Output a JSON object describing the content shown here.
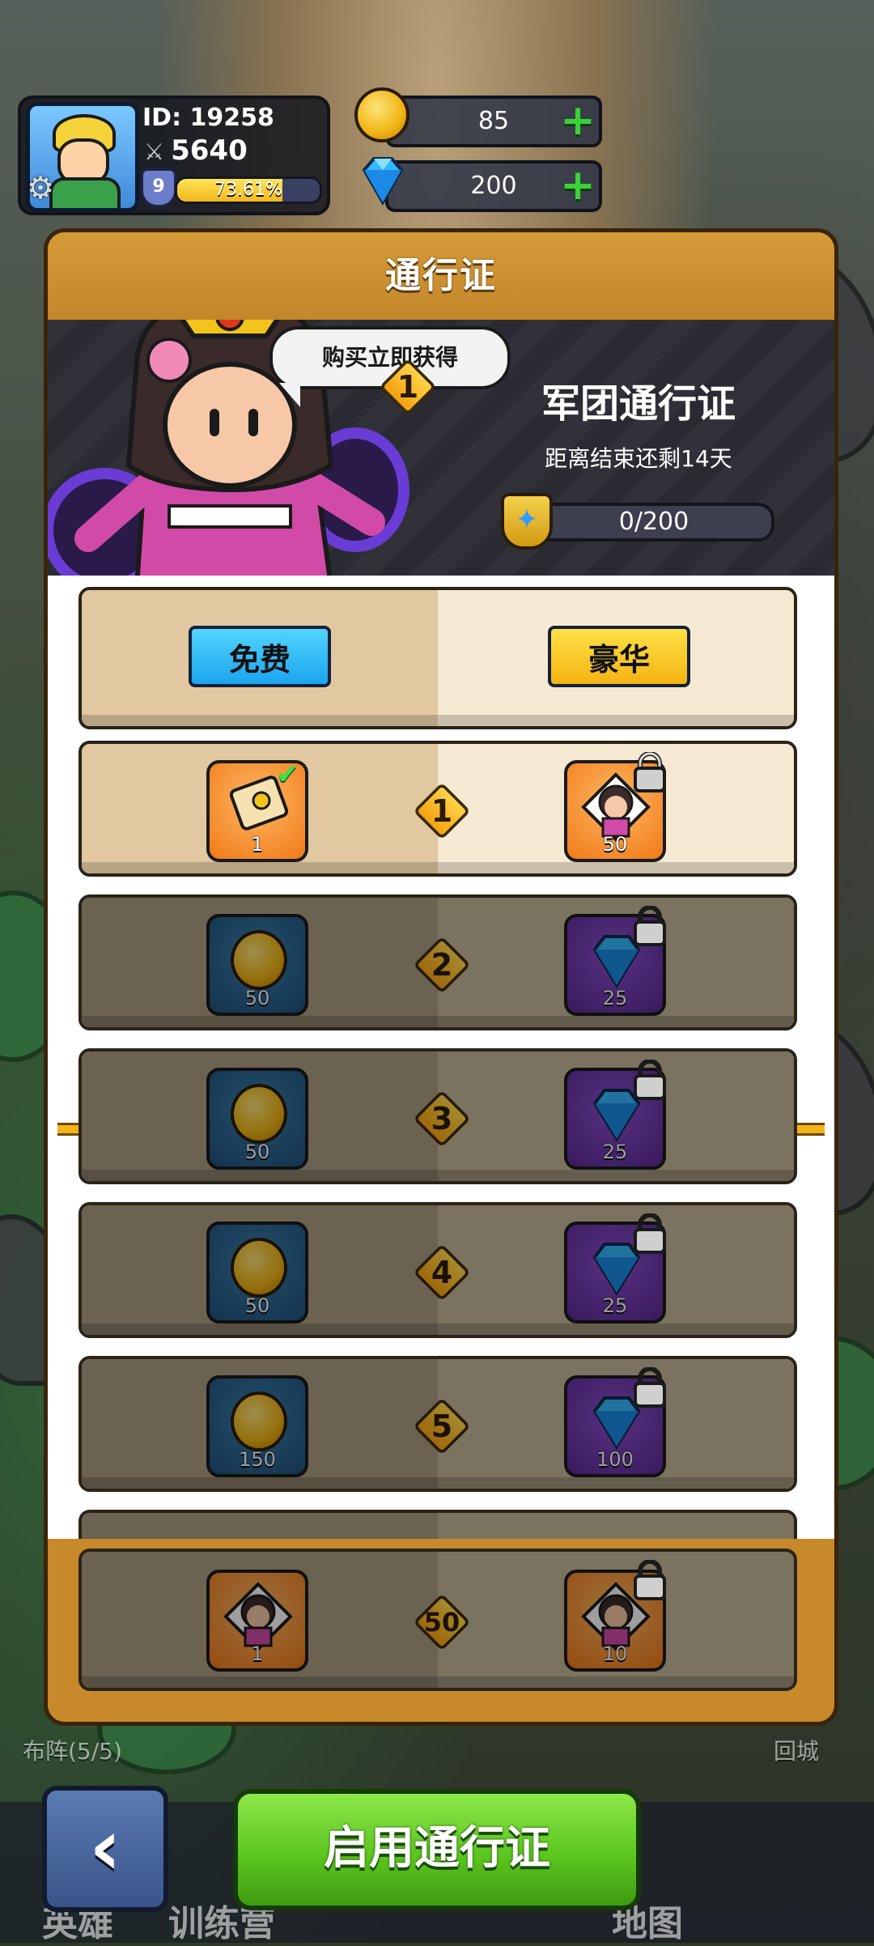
{
  "player": {
    "id_label": "ID: 19258",
    "power": "5640",
    "level": "9",
    "xp_percent_text": "73.61%",
    "xp_fraction": 0.7361
  },
  "currency": {
    "gold": "85",
    "gems": "200"
  },
  "modal": {
    "title": "通行证",
    "bubble": "购买立即获得",
    "pass_name": "军团通行证",
    "remaining": "距离结束还剩14天",
    "progress": "0/200",
    "progress_level": "1"
  },
  "tiers": {
    "free_label": "免费",
    "lux_label": "豪华"
  },
  "rows": [
    {
      "level": "1",
      "free_qty": "1",
      "lux_qty": "50"
    },
    {
      "level": "2",
      "free_qty": "50",
      "lux_qty": "25"
    },
    {
      "level": "3",
      "free_qty": "50",
      "lux_qty": "25"
    },
    {
      "level": "4",
      "free_qty": "50",
      "lux_qty": "25"
    },
    {
      "level": "5",
      "free_qty": "150",
      "lux_qty": "100"
    },
    {
      "level": "50",
      "free_qty": "1",
      "lux_qty": "10"
    }
  ],
  "divider_cost": "50",
  "side_labels": {
    "left": "布阵(5/5)",
    "right": "回城"
  },
  "nav": {
    "heroes": "英雄",
    "training": "训练营",
    "map": "地图"
  },
  "buttons": {
    "activate": "启用通行证"
  },
  "colors": {
    "modal_frame": "#c7892a",
    "free_tag": "#1aa5ee",
    "lux_tag": "#f4b312",
    "activate": "#58c21c"
  }
}
